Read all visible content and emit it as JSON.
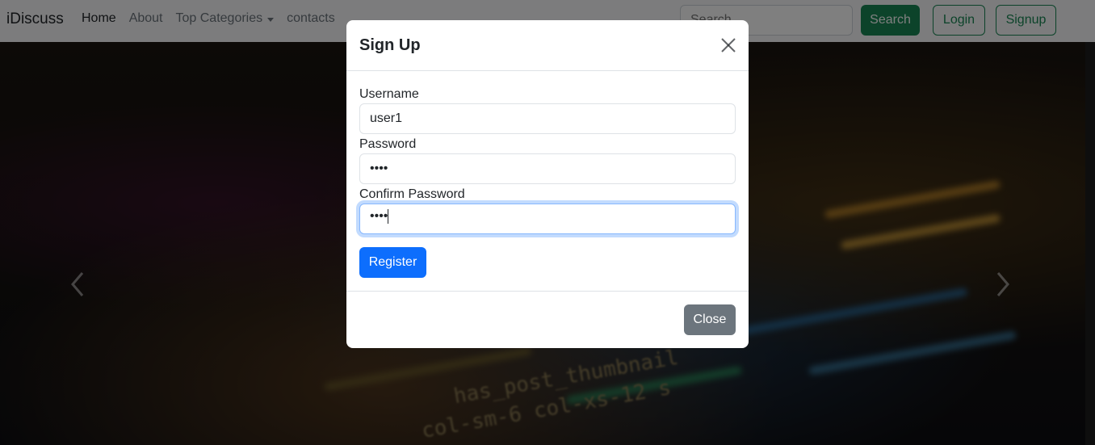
{
  "navbar": {
    "brand": "iDiscuss",
    "links": [
      {
        "label": "Home"
      },
      {
        "label": "About"
      },
      {
        "label": "Top Categories"
      },
      {
        "label": "contacts"
      }
    ],
    "search_placeholder": "Search",
    "search_button": "Search",
    "login_button": "Login",
    "signup_button": "Signup"
  },
  "hero": {
    "code_lines": [
      "has_post_thumbnail",
      "col-sm-6 col-xs-12 s"
    ]
  },
  "modal": {
    "title": "Sign Up",
    "fields": [
      {
        "label": "Username",
        "value": "user1"
      },
      {
        "label": "Password",
        "value": "••••"
      },
      {
        "label": "Confirm Password",
        "value": "••••"
      }
    ],
    "register_button": "Register",
    "close_button": "Close"
  },
  "colors": {
    "primary": "#0d6efd",
    "success": "#198754",
    "secondary": "#6c757d"
  }
}
